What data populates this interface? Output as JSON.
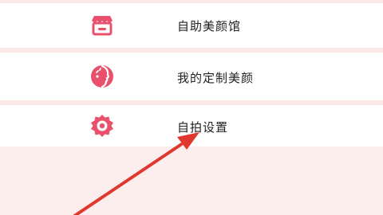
{
  "colors": {
    "accent": "#e8506b",
    "background": "#fdeeee",
    "item_background": "#ffffff",
    "text": "#222222",
    "annotation_arrow": "#e0382f"
  },
  "menu": {
    "items": [
      {
        "label": "自助美颜馆",
        "icon": "storefront-icon"
      },
      {
        "label": "我的定制美颜",
        "icon": "face-profile-icon"
      },
      {
        "label": "自拍设置",
        "icon": "gear-icon"
      }
    ]
  }
}
